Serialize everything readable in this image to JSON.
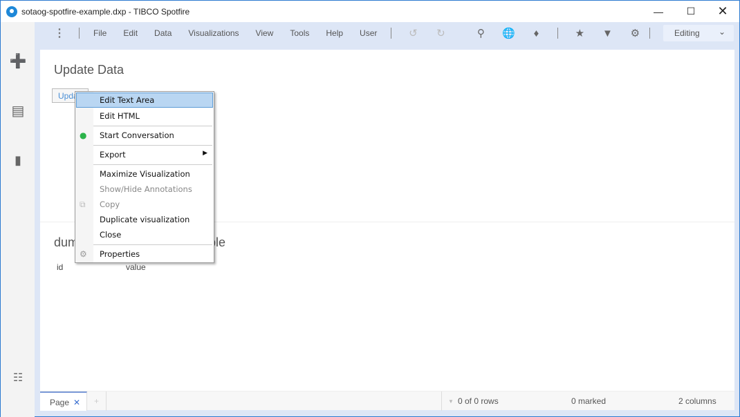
{
  "window": {
    "title": "sotaog-spotfire-example.dxp - TIBCO Spotfire",
    "controls": [
      "minimize",
      "maximize",
      "close"
    ]
  },
  "sidebar": {
    "icons": [
      "add-icon",
      "pages-icon",
      "visualization-icon",
      "data-canvas-icon"
    ]
  },
  "toolbar": {
    "menus": [
      "File",
      "Edit",
      "Data",
      "Visualizations",
      "View",
      "Tools",
      "Help",
      "User"
    ],
    "mode": "Editing"
  },
  "page": {
    "title": "Update Data",
    "button_label": "Update",
    "table_title_start": "dum",
    "table_title_end": "ple",
    "columns": [
      "id",
      "value"
    ]
  },
  "context_menu": {
    "items": [
      {
        "label": "Edit Text Area",
        "highlighted": true
      },
      {
        "label": "Edit HTML"
      },
      {
        "label": "Start Conversation",
        "icon": "conversation-icon"
      },
      {
        "label": "Export",
        "submenu": true
      },
      {
        "label": "Maximize Visualization"
      },
      {
        "label": "Show/Hide Annotations",
        "disabled": true
      },
      {
        "label": "Copy",
        "disabled": true,
        "icon": "copy-icon"
      },
      {
        "label": "Duplicate visualization"
      },
      {
        "label": "Close"
      },
      {
        "label": "Properties",
        "icon": "gear-icon"
      }
    ]
  },
  "status": {
    "tab": "Page",
    "rows": "0 of 0 rows",
    "marked": "0 marked",
    "columns": "2 columns"
  }
}
